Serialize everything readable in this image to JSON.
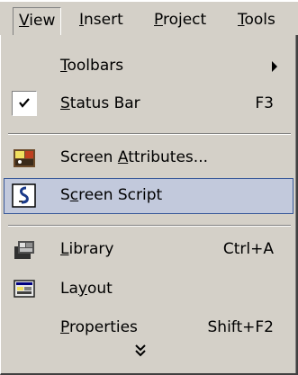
{
  "menubar": {
    "items": [
      {
        "label": "View",
        "underline": "V",
        "rest": "iew"
      },
      {
        "label": "Insert",
        "underline": "I",
        "rest": "nsert"
      },
      {
        "label": "Project",
        "underline": "P",
        "rest": "roject"
      },
      {
        "label": "Tools",
        "underline": "T",
        "rest": "ools"
      }
    ]
  },
  "menu": {
    "items": [
      {
        "pre": "",
        "u": "T",
        "post": "oolbars",
        "shortcut": ""
      },
      {
        "pre": "",
        "u": "S",
        "post": "tatus Bar",
        "shortcut": "F3"
      },
      {
        "pre": "Screen ",
        "u": "A",
        "post": "ttributes...",
        "shortcut": ""
      },
      {
        "pre": "S",
        "u": "c",
        "post": "reen Script",
        "shortcut": ""
      },
      {
        "pre": "",
        "u": "L",
        "post": "ibrary",
        "shortcut": "Ctrl+A"
      },
      {
        "pre": "La",
        "u": "y",
        "post": "out",
        "shortcut": ""
      },
      {
        "pre": "",
        "u": "P",
        "post": "roperties",
        "shortcut": "Shift+F2"
      }
    ],
    "more_glyph": "⌄⌄"
  },
  "colors": {
    "face": "#d4d0c8",
    "highlight_bg": "#c2c9dc",
    "highlight_border": "#3a5a9a"
  }
}
